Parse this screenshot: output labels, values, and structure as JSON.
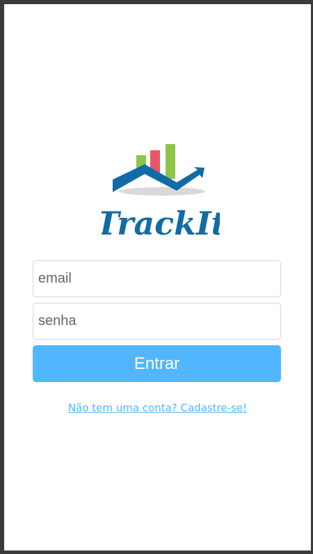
{
  "app": {
    "logo_text": "TrackIt",
    "logo_icon": "chart-arrow-logo"
  },
  "login": {
    "email_placeholder": "email",
    "password_placeholder": "senha",
    "submit_label": "Entrar",
    "signup_link": "Não tem uma conta? Cadastre-se!"
  },
  "colors": {
    "accent": "#52b6ff",
    "logo_blue": "#126ba5",
    "bar_green": "#8fc549",
    "bar_red": "#e75766"
  }
}
